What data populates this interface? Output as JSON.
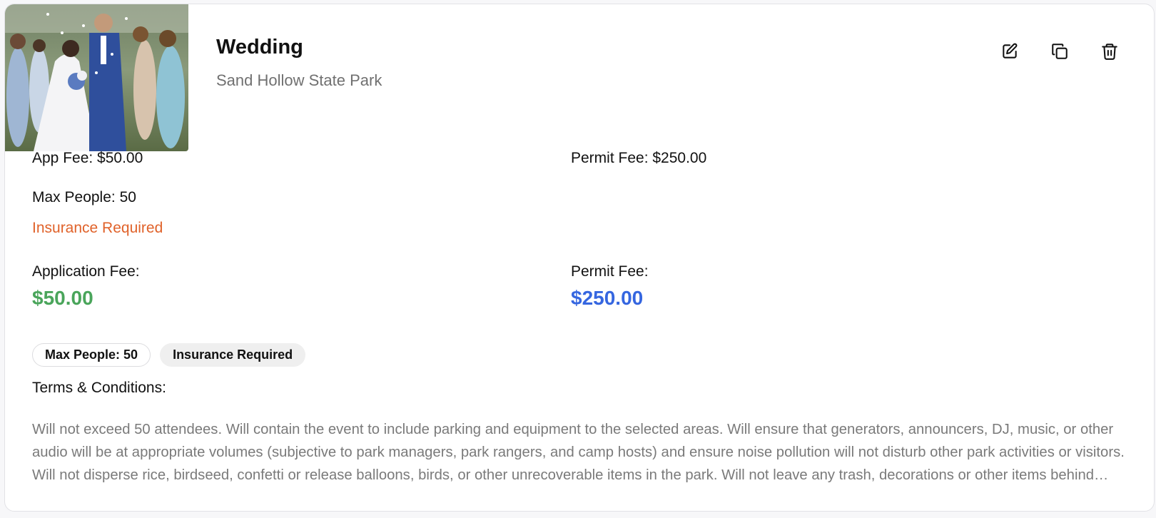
{
  "event": {
    "title": "Wedding",
    "location": "Sand Hollow State Park",
    "thumbnail_alt": "wedding-photo"
  },
  "actions": {
    "edit_icon": "edit-icon",
    "duplicate_icon": "copy-icon",
    "delete_icon": "trash-icon"
  },
  "summary": {
    "app_fee": "App Fee: $50.00",
    "permit_fee": "Permit Fee: $250.00",
    "max_people": "Max People: 50",
    "insurance": "Insurance Required"
  },
  "fees": {
    "application_label": "Application Fee:",
    "application_value": "$50.00",
    "permit_label": "Permit Fee:",
    "permit_value": "$250.00"
  },
  "chips": {
    "max_people": "Max People: 50",
    "insurance": "Insurance Required"
  },
  "terms": {
    "label": "Terms & Conditions:",
    "text": "Will not exceed 50 attendees. Will contain the event to include parking and equipment to the selected areas. Will ensure that generators, announcers, DJ, music, or other audio will be at appropriate volumes (subjective to park managers, park rangers, and camp hosts) and ensure noise pollution will not disturb other park activities or visitors. Will not disperse rice, birdseed, confetti or release balloons, birds, or other unrecoverable items in the park. Will not leave any trash, decorations or other items behind after the event."
  },
  "colors": {
    "warning": "#e0622a",
    "application_fee": "#4aa55b",
    "permit_fee": "#3566e0"
  }
}
